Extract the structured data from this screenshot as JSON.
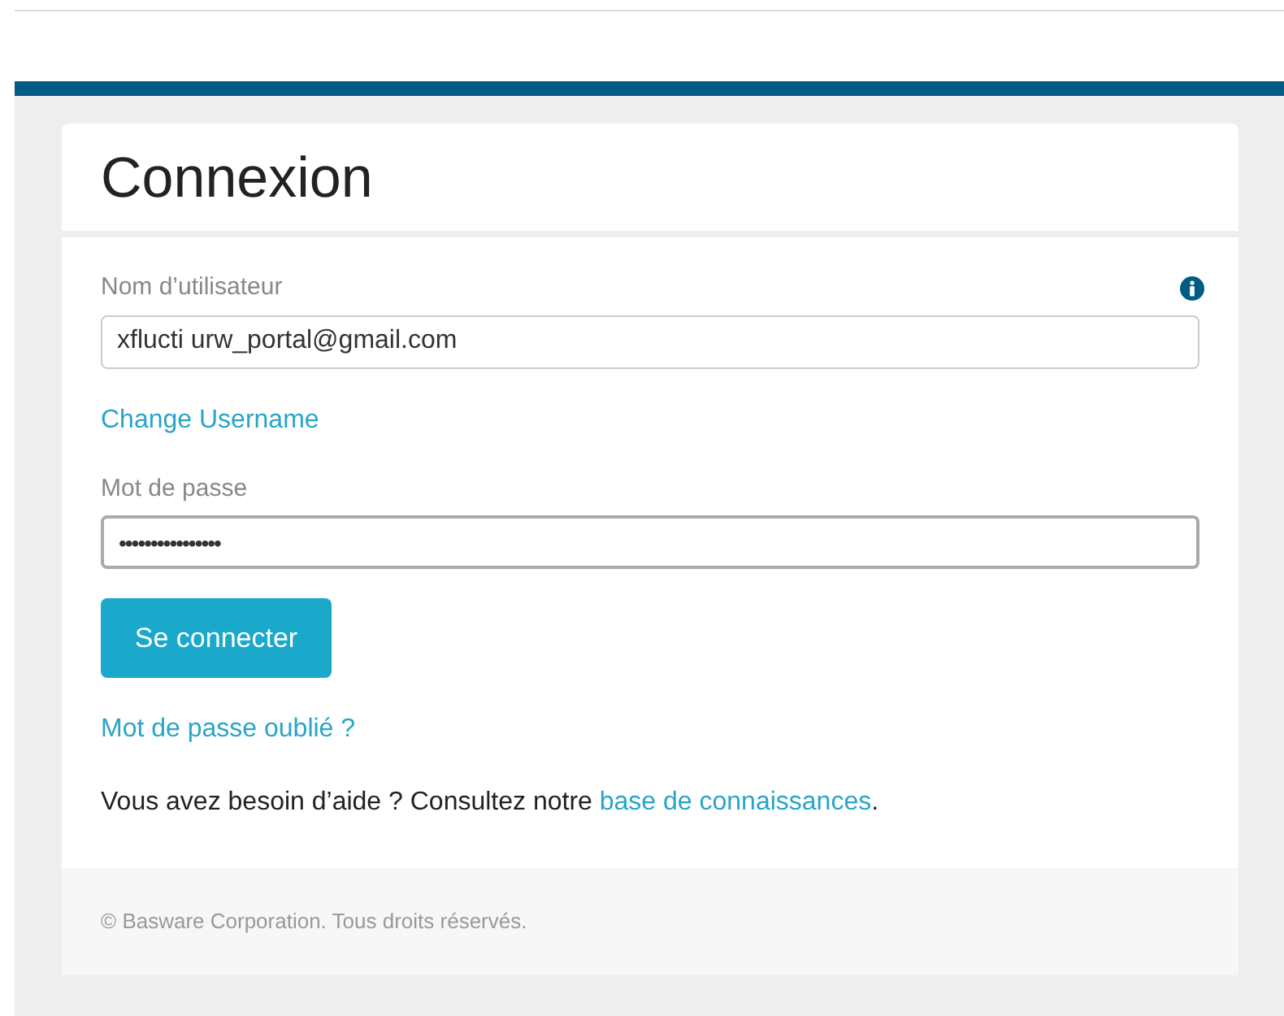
{
  "title": "Connexion",
  "username": {
    "label": "Nom d’utilisateur",
    "value": "xflucti urw_portal@gmail.com"
  },
  "change_username_link": "Change Username",
  "password": {
    "label": "Mot de passe",
    "value": "••••••••••••••••"
  },
  "submit_button": "Se connecter",
  "forgot_password_link": "Mot de passe oublié ?",
  "help": {
    "text": "Vous avez besoin d’aide ? Consultez notre ",
    "link": "base de connaissances",
    "end": "."
  },
  "footer": "© Basware Corporation. Tous droits réservés."
}
